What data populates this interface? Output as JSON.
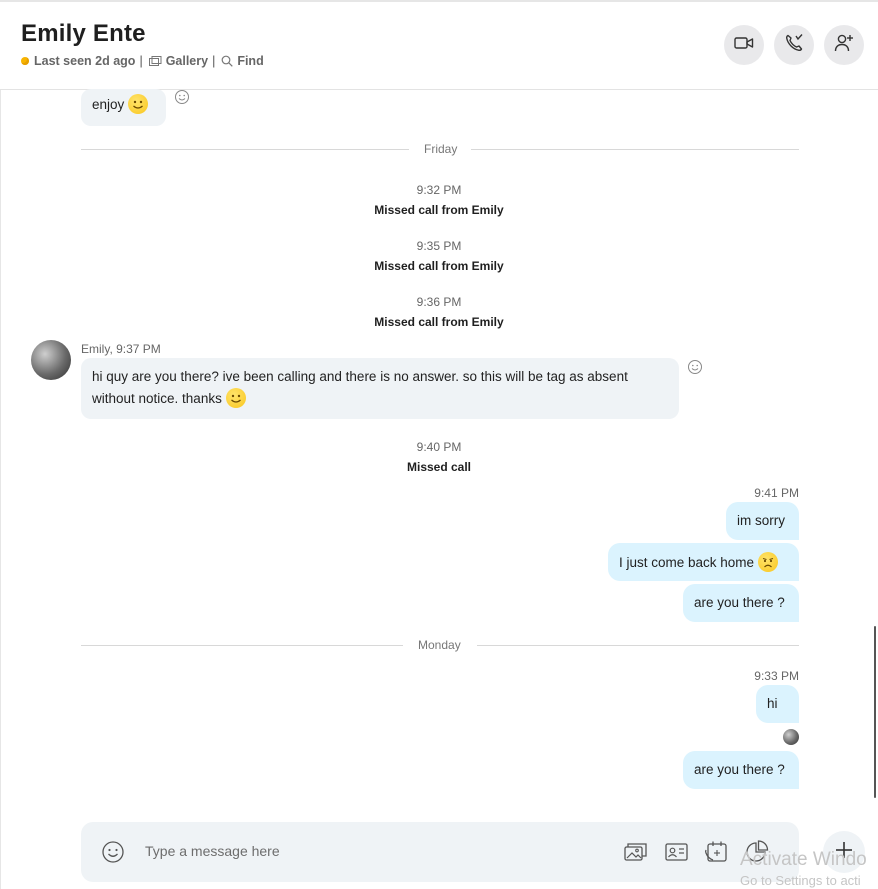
{
  "header": {
    "title": "Emily Ente",
    "last_seen": "Last seen 2d ago",
    "separator": "|",
    "gallery_label": "Gallery",
    "find_label": "Find"
  },
  "conversation": {
    "msg_enjoy": "enjoy",
    "day_friday": "Friday",
    "events": [
      {
        "time": "9:32 PM",
        "text": "Missed call from Emily"
      },
      {
        "time": "9:35 PM",
        "text": "Missed call from Emily"
      },
      {
        "time": "9:36 PM",
        "text": "Missed call from Emily"
      }
    ],
    "emily_header": "Emily, 9:37 PM",
    "emily_msg_line1": "hi quy are you there? ive been calling and there is no answer. so this will be tag as absent",
    "emily_msg_line2": "without notice. thanks",
    "missed_time": "9:40 PM",
    "missed_text": "Missed call",
    "out_group1_time": "9:41 PM",
    "out_group1": [
      "im sorry",
      "I just come back home",
      "are you there ?"
    ],
    "day_monday": "Monday",
    "out_group2_time": "9:33 PM",
    "out_group2": [
      "hi",
      "are you there ?"
    ]
  },
  "composer": {
    "placeholder": "Type a message here"
  },
  "watermark": {
    "line1": "Activate Windo",
    "line2": "Go to Settings to acti"
  },
  "colors": {
    "incoming_bubble": "#eff3f6",
    "outgoing_bubble": "#dbf3fe",
    "status_away": "#f8b400"
  },
  "icons": [
    "video-call-icon",
    "audio-call-icon",
    "add-people-icon",
    "gallery-icon",
    "search-icon",
    "reaction-icon",
    "emoji-icon",
    "media-icon",
    "contact-card-icon",
    "schedule-call-icon",
    "poll-icon",
    "plus-icon"
  ]
}
